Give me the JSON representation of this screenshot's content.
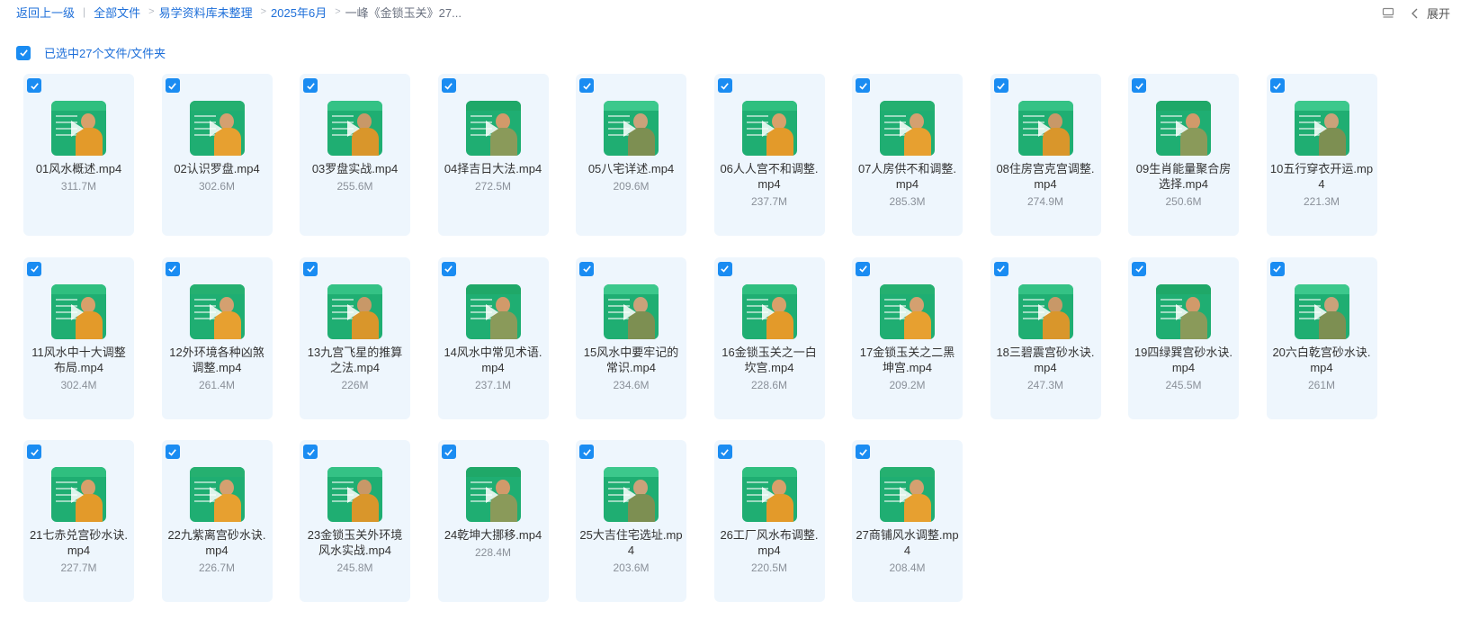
{
  "breadcrumb": {
    "back": "返回上一级",
    "items": [
      "全部文件",
      "易学资料库未整理",
      "2025年6月"
    ],
    "current": "一峰《金锁玉关》27..."
  },
  "toolbar": {
    "expand_label": "展开",
    "list_view_icon": "list-view-icon",
    "collapse_icon": "chevron-left-icon"
  },
  "selection": {
    "label": "已选中27个文件/文件夹"
  },
  "colors": {
    "accent": "#1a8cf2",
    "tile_bg": "#eef6fd",
    "thumb_green": "#1fae72"
  },
  "files": [
    {
      "name": "01风水概述.mp4",
      "size": "311.7M"
    },
    {
      "name": "02认识罗盘.mp4",
      "size": "302.6M"
    },
    {
      "name": "03罗盘实战.mp4",
      "size": "255.6M"
    },
    {
      "name": "04择吉日大法.mp4",
      "size": "272.5M"
    },
    {
      "name": "05八宅详述.mp4",
      "size": "209.6M"
    },
    {
      "name": "06人人宫不和调整.mp4",
      "size": "237.7M"
    },
    {
      "name": "07人房供不和调整.mp4",
      "size": "285.3M"
    },
    {
      "name": "08住房宫克宫调整.mp4",
      "size": "274.9M"
    },
    {
      "name": "09生肖能量聚合房选择.mp4",
      "size": "250.6M"
    },
    {
      "name": "10五行穿衣开运.mp4",
      "size": "221.3M"
    },
    {
      "name": "11风水中十大调整布局.mp4",
      "size": "302.4M"
    },
    {
      "name": "12外环境各种凶煞调整.mp4",
      "size": "261.4M"
    },
    {
      "name": "13九宫飞星的推算之法.mp4",
      "size": "226M"
    },
    {
      "name": "14风水中常见术语.mp4",
      "size": "237.1M"
    },
    {
      "name": "15风水中要牢记的常识.mp4",
      "size": "234.6M"
    },
    {
      "name": "16金锁玉关之一白坎宫.mp4",
      "size": "228.6M"
    },
    {
      "name": "17金锁玉关之二黑坤宫.mp4",
      "size": "209.2M"
    },
    {
      "name": "18三碧震宫砂水诀.mp4",
      "size": "247.3M"
    },
    {
      "name": "19四绿巽宫砂水诀.mp4",
      "size": "245.5M"
    },
    {
      "name": "20六白乾宫砂水诀.mp4",
      "size": "261M"
    },
    {
      "name": "21七赤兑宫砂水诀.mp4",
      "size": "227.7M"
    },
    {
      "name": "22九紫离宫砂水诀.mp4",
      "size": "226.7M"
    },
    {
      "name": "23金锁玉关外环境风水实战.mp4",
      "size": "245.8M"
    },
    {
      "name": "24乾坤大挪移.mp4",
      "size": "228.4M"
    },
    {
      "name": "25大吉住宅选址.mp4",
      "size": "203.6M"
    },
    {
      "name": "26工厂风水布调整.mp4",
      "size": "220.5M"
    },
    {
      "name": "27商铺风水调整.mp4",
      "size": "208.4M"
    }
  ]
}
